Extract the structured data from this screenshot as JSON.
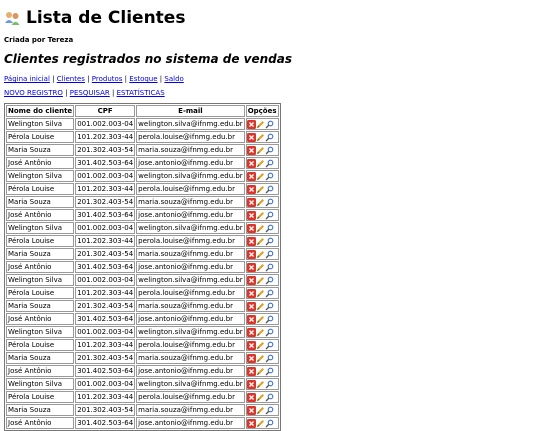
{
  "title": "Lista de Clientes",
  "author": "Criada por Tereza",
  "subtitle": "Clientes registrados no sistema de vendas",
  "nav_main": [
    "Página inicial",
    "Clientes",
    "Produtos",
    "Estoque",
    "Saldo"
  ],
  "nav_actions": [
    "NOVO REGISTRO",
    "PESQUISAR",
    "ESTATÍSTICAS"
  ],
  "table": {
    "headers": [
      "Nome do cliente",
      "CPF",
      "E-mail",
      "Opções"
    ],
    "rows": [
      [
        "Welington Silva",
        "001.002.003-04",
        "welington.silva@ifnmg.edu.br"
      ],
      [
        "Pérola Louise",
        "101.202.303-44",
        "perola.louise@ifnmg.edu.br"
      ],
      [
        "Maria Souza",
        "201.302.403-54",
        "maria.souza@ifnmg.edu.br"
      ],
      [
        "José Antônio",
        "301.402.503-64",
        "jose.antonio@ifnmg.edu.br"
      ],
      [
        "Welington Silva",
        "001.002.003-04",
        "welington.silva@ifnmg.edu.br"
      ],
      [
        "Pérola Louise",
        "101.202.303-44",
        "perola.louise@ifnmg.edu.br"
      ],
      [
        "Maria Souza",
        "201.302.403-54",
        "maria.souza@ifnmg.edu.br"
      ],
      [
        "José Antônio",
        "301.402.503-64",
        "jose.antonio@ifnmg.edu.br"
      ],
      [
        "Welington Silva",
        "001.002.003-04",
        "welington.silva@ifnmg.edu.br"
      ],
      [
        "Pérola Louise",
        "101.202.303-44",
        "perola.louise@ifnmg.edu.br"
      ],
      [
        "Maria Souza",
        "201.302.403-54",
        "maria.souza@ifnmg.edu.br"
      ],
      [
        "José Antônio",
        "301.402.503-64",
        "jose.antonio@ifnmg.edu.br"
      ],
      [
        "Welington Silva",
        "001.002.003-04",
        "welington.silva@ifnmg.edu.br"
      ],
      [
        "Pérola Louise",
        "101.202.303-44",
        "perola.louise@ifnmg.edu.br"
      ],
      [
        "Maria Souza",
        "201.302.403-54",
        "maria.souza@ifnmg.edu.br"
      ],
      [
        "José Antônio",
        "301.402.503-64",
        "jose.antonio@ifnmg.edu.br"
      ],
      [
        "Welington Silva",
        "001.002.003-04",
        "welington.silva@ifnmg.edu.br"
      ],
      [
        "Pérola Louise",
        "101.202.303-44",
        "perola.louise@ifnmg.edu.br"
      ],
      [
        "Maria Souza",
        "201.302.403-54",
        "maria.souza@ifnmg.edu.br"
      ],
      [
        "José Antônio",
        "301.402.503-64",
        "jose.antonio@ifnmg.edu.br"
      ],
      [
        "Welington Silva",
        "001.002.003-04",
        "welington.silva@ifnmg.edu.br"
      ],
      [
        "Pérola Louise",
        "101.202.303-44",
        "perola.louise@ifnmg.edu.br"
      ],
      [
        "Maria Souza",
        "201.302.403-54",
        "maria.souza@ifnmg.edu.br"
      ],
      [
        "José Antônio",
        "301.402.503-64",
        "jose.antonio@ifnmg.edu.br"
      ]
    ],
    "row_icons": [
      "delete-icon",
      "edit-icon",
      "view-icon"
    ]
  },
  "colors": {
    "link": "#0000ee",
    "delete": "#d9372b",
    "edit": "#e0a020",
    "view": "#3b6fd0"
  }
}
